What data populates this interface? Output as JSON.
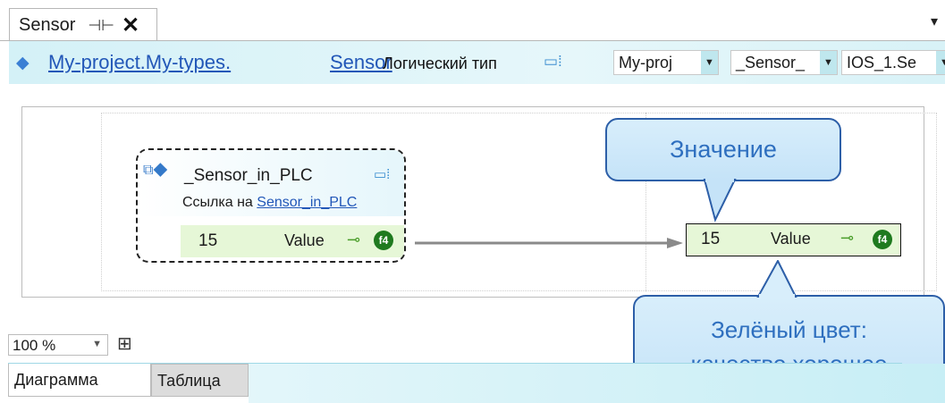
{
  "tab": {
    "title": "Sensor",
    "pin_icon": "pin-icon",
    "close_label": "✕"
  },
  "header": {
    "breadcrumb_parent": "My-project.My-types.",
    "breadcrumb_current": "Sensor",
    "kind_label": "Логический тип",
    "combos": [
      "My-proj",
      "_Sensor_",
      "IOS_1.Se"
    ]
  },
  "node": {
    "name": "_Sensor_in_PLC",
    "ref_prefix": "Ссылка на",
    "ref_link": "Sensor_in_PLC",
    "row_value": "15",
    "row_label": "Value",
    "badge": "f4"
  },
  "target": {
    "value": "15",
    "label": "Value",
    "badge": "f4"
  },
  "callouts": {
    "value": "Значение",
    "quality_line1": "Зелёный цвет:",
    "quality_line2": "качество хорошее"
  },
  "zoom": {
    "value": "100 %"
  },
  "bottom_tabs": [
    "Диаграмма",
    "Таблица"
  ],
  "colors": {
    "good_quality": "#e6f7d7",
    "link": "#2257b8",
    "callout_text": "#2e6fbf"
  }
}
